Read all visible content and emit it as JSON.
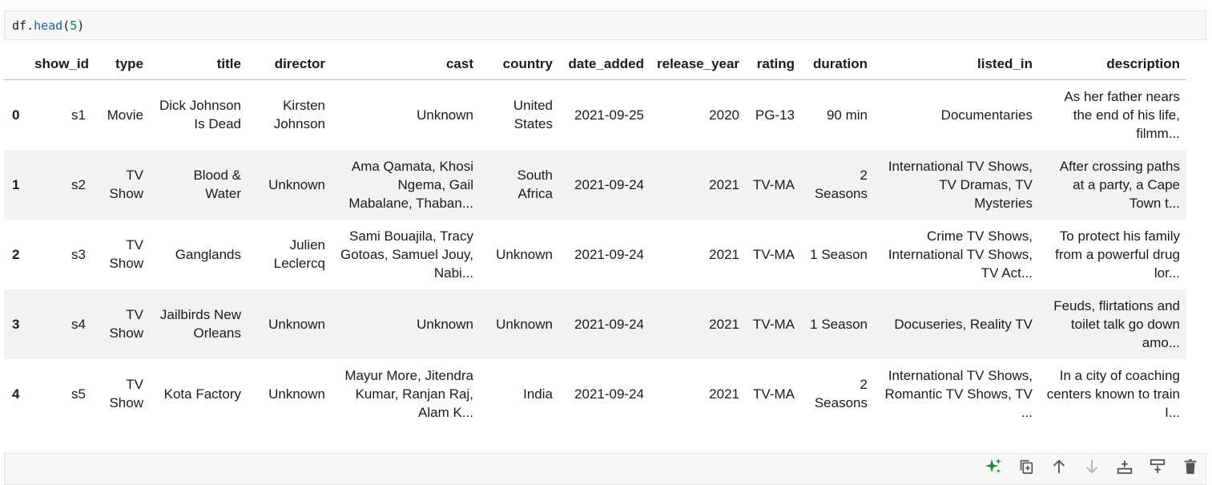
{
  "code_cell": {
    "code": {
      "name": "df",
      "dot": ".",
      "method": "head",
      "open": "(",
      "arg": "5",
      "close": ")"
    }
  },
  "table": {
    "columns": [
      "",
      "show_id",
      "type",
      "title",
      "director",
      "cast",
      "country",
      "date_added",
      "release_year",
      "rating",
      "duration",
      "listed_in",
      "description"
    ],
    "rows": [
      {
        "index": "0",
        "cells": [
          "s1",
          "Movie",
          "Dick Johnson Is Dead",
          "Kirsten Johnson",
          "Unknown",
          "United States",
          "2021-09-25",
          "2020",
          "PG-13",
          "90 min",
          "Documentaries",
          "As her father nears the end of his life, filmm..."
        ]
      },
      {
        "index": "1",
        "cells": [
          "s2",
          "TV Show",
          "Blood & Water",
          "Unknown",
          "Ama Qamata, Khosi Ngema, Gail Mabalane, Thaban...",
          "South Africa",
          "2021-09-24",
          "2021",
          "TV-MA",
          "2 Seasons",
          "International TV Shows, TV Dramas, TV Mysteries",
          "After crossing paths at a party, a Cape Town t..."
        ]
      },
      {
        "index": "2",
        "cells": [
          "s3",
          "TV Show",
          "Ganglands",
          "Julien Leclercq",
          "Sami Bouajila, Tracy Gotoas, Samuel Jouy, Nabi...",
          "Unknown",
          "2021-09-24",
          "2021",
          "TV-MA",
          "1 Season",
          "Crime TV Shows, International TV Shows, TV Act...",
          "To protect his family from a powerful drug lor..."
        ]
      },
      {
        "index": "3",
        "cells": [
          "s4",
          "TV Show",
          "Jailbirds New Orleans",
          "Unknown",
          "Unknown",
          "Unknown",
          "2021-09-24",
          "2021",
          "TV-MA",
          "1 Season",
          "Docuseries, Reality TV",
          "Feuds, flirtations and toilet talk go down amo..."
        ]
      },
      {
        "index": "4",
        "cells": [
          "s5",
          "TV Show",
          "Kota Factory",
          "Unknown",
          "Mayur More, Jitendra Kumar, Ranjan Raj, Alam K...",
          "India",
          "2021-09-24",
          "2021",
          "TV-MA",
          "2 Seasons",
          "International TV Shows, Romantic TV Shows, TV ...",
          "In a city of coaching centers known to train I..."
        ]
      }
    ]
  },
  "toolbar": {
    "icons": [
      "sparkle-icon",
      "copy-icon",
      "arrow-up-icon",
      "arrow-down-icon",
      "insert-below-icon",
      "insert-above-icon",
      "trash-icon"
    ],
    "colors": {
      "sparkle": "#1e8a3a",
      "icon": "#555555",
      "icon_disabled": "#b5b5b5"
    }
  }
}
